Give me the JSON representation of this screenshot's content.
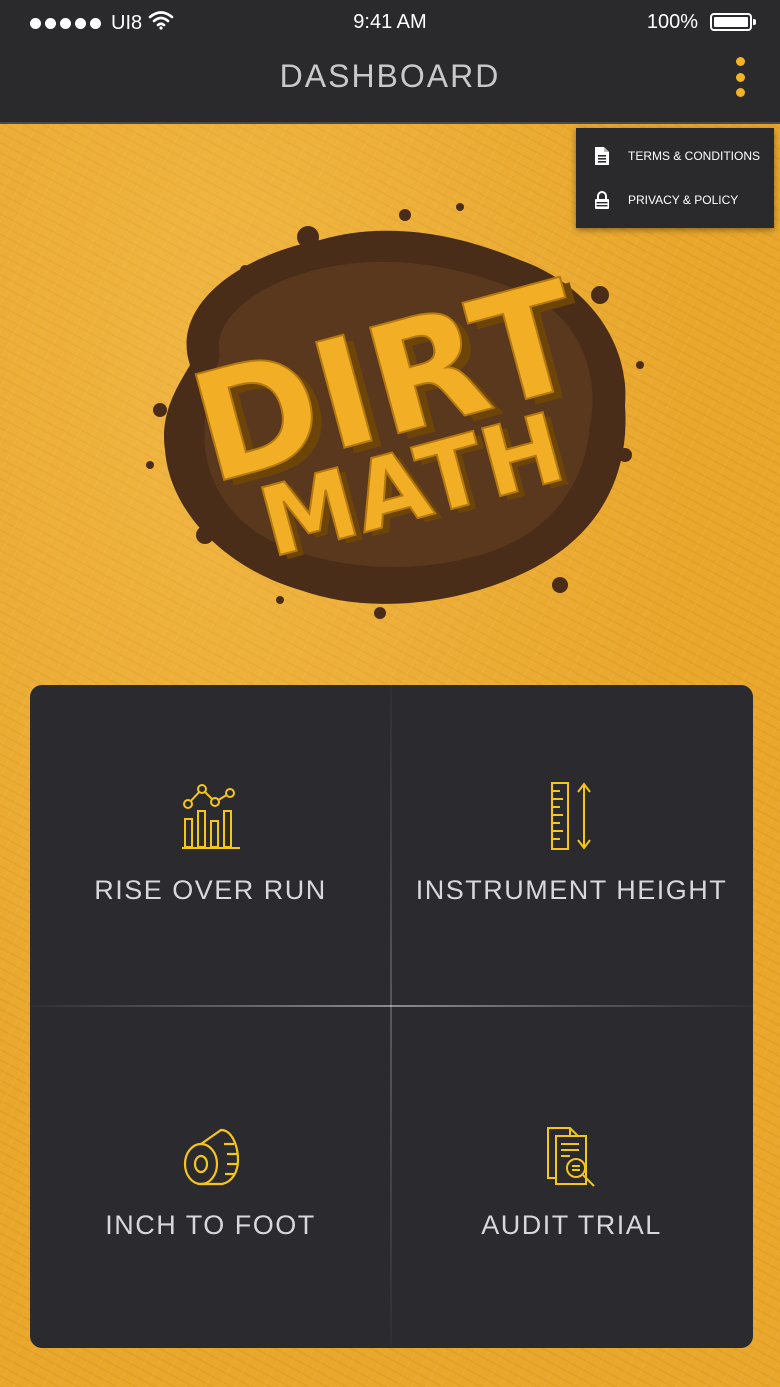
{
  "status_bar": {
    "carrier": "UI8",
    "time": "9:41 AM",
    "battery": "100%"
  },
  "header": {
    "title": "DASHBOARD"
  },
  "menu": {
    "items": [
      {
        "label": "TERMS & CONDITIONS",
        "icon": "document-icon"
      },
      {
        "label": "PRIVACY & POLICY",
        "icon": "lock-icon"
      }
    ]
  },
  "logo": {
    "line1": "DIRT",
    "line2": "MATH"
  },
  "tiles": [
    {
      "label": "RISE OVER RUN",
      "icon": "bar-chart-icon"
    },
    {
      "label": "INSTRUMENT HEIGHT",
      "icon": "ruler-height-icon"
    },
    {
      "label": "INCH TO FOOT",
      "icon": "tape-measure-icon"
    },
    {
      "label": "AUDIT TRIAL",
      "icon": "document-search-icon"
    }
  ],
  "colors": {
    "accent": "#f5c518",
    "dark": "#2a2a2d",
    "background": "#e9a72c"
  }
}
